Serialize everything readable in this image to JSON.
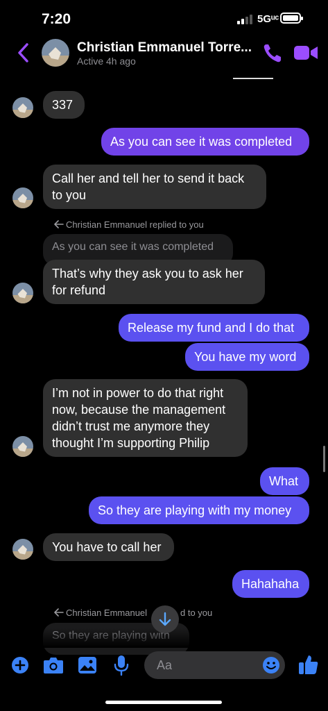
{
  "status_bar": {
    "time": "7:20",
    "network": "5Gᵘᶜ"
  },
  "header": {
    "name": "Christian Emmanuel Torre...",
    "active": "Active 4h ago"
  },
  "messages": {
    "m1": "337",
    "m2": "As you can see it was completed",
    "m3": "Call her and tell her to send it back to you",
    "reply1_label": "Christian Emmanuel replied to you",
    "reply1_quote": "As you can see it was completed",
    "m4": "That’s why they ask you to ask her for refund",
    "m5": "Release my fund and I do that",
    "m6": "You have my word",
    "m7": "I’m not in power to do that right now, because the management didn’t trust me anymore they thought I’m supporting Philip",
    "m8": "What",
    "m9": "So they are playing with my money",
    "m10": "You have to call her",
    "m11": "Hahahaha",
    "reply2_label": "Christian Emmanuel",
    "reply2_label_end": "d to you",
    "reply2_quote": "So they are playing with"
  },
  "composer": {
    "placeholder": "Aa"
  },
  "colors": {
    "accent": "#9b4dff",
    "outgoing": "#5b51f0",
    "incoming": "#303030"
  }
}
